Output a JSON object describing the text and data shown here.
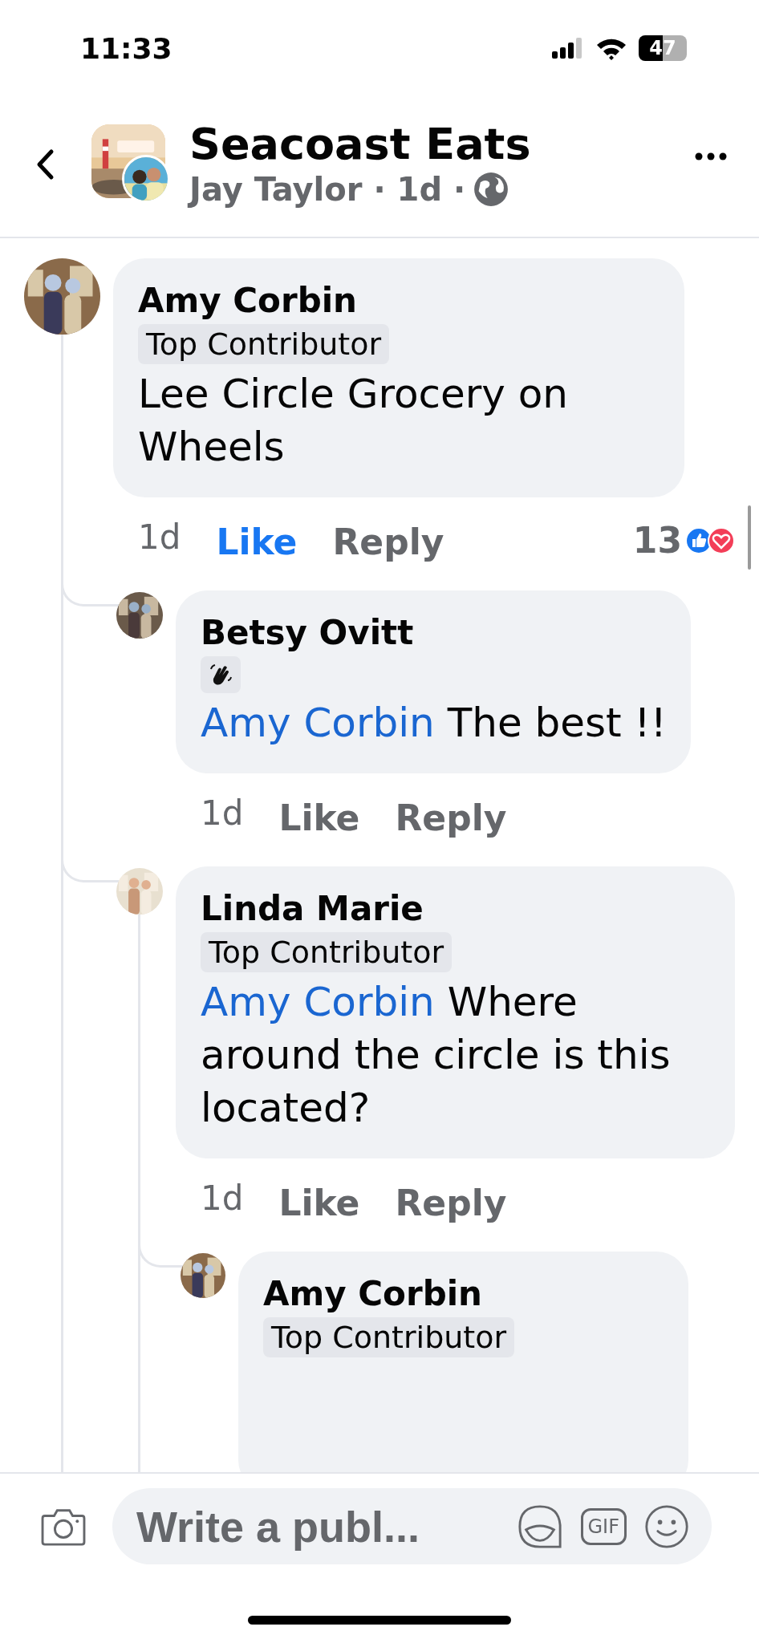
{
  "status_bar": {
    "time": "11:33",
    "battery": "47"
  },
  "header": {
    "title": "Seacoast Eats",
    "meta": "Jay Taylor · 1d ·"
  },
  "comments": [
    {
      "author": "Amy Corbin",
      "badge": {
        "kind": "label",
        "label": "Top Contributor"
      },
      "text": "Lee Circle Grocery on Wheels",
      "time": "1d",
      "like": "Like",
      "reply": "Reply",
      "liked": true,
      "reaction_count": "13",
      "children": [
        {
          "author": "Betsy Ovitt",
          "badge": {
            "kind": "wave"
          },
          "mention": "Amy Corbin",
          "text": "The best !!",
          "time": "1d",
          "like": "Like",
          "reply": "Reply",
          "liked": false
        },
        {
          "author": "Linda Marie",
          "badge": {
            "kind": "label",
            "label": "Top Contributor"
          },
          "mention": "Amy Corbin",
          "text": "Where around the circle is this located?",
          "time": "1d",
          "like": "Like",
          "reply": "Reply",
          "liked": false,
          "children": [
            {
              "author": "Amy Corbin",
              "badge": {
                "kind": "label",
                "label": "Top Contributor"
              }
            }
          ]
        }
      ]
    }
  ],
  "composer": {
    "placeholder": "Write a publ...",
    "gif": "GIF"
  }
}
